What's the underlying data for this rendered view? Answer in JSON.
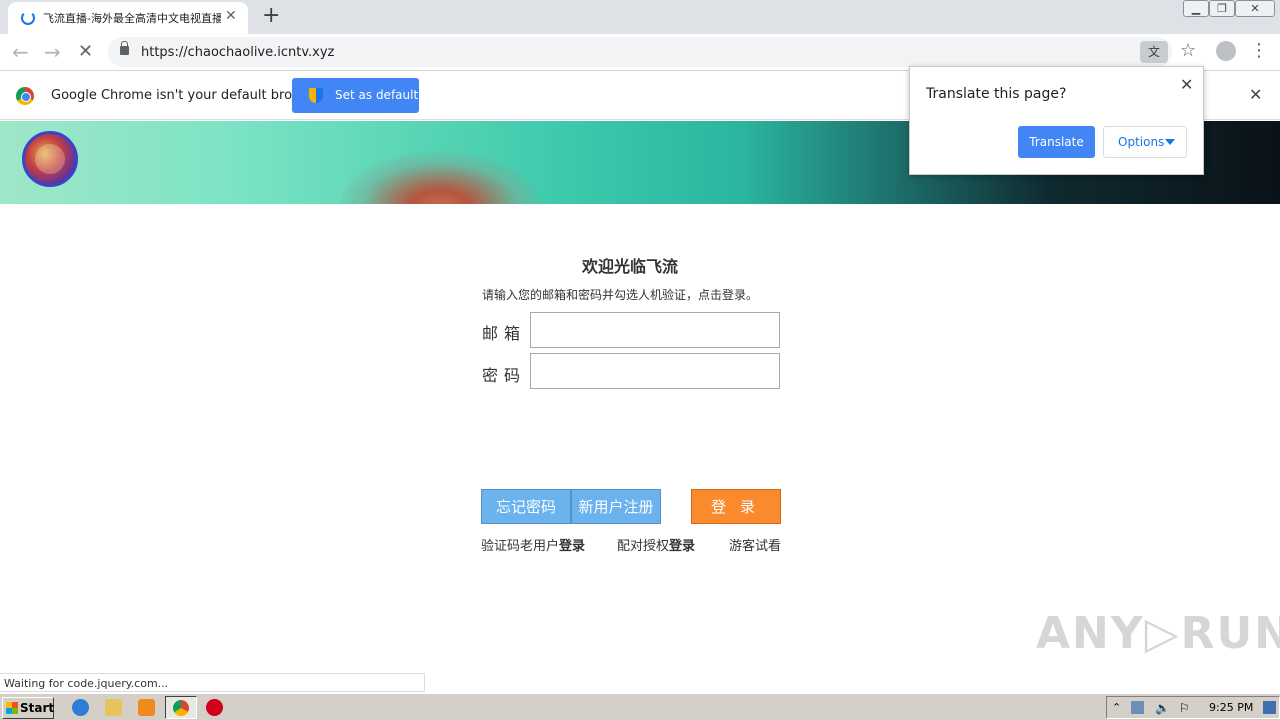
{
  "browser": {
    "tab_title": "飞流直播-海外最全高清中文电视直播",
    "url": "https://chaochaolive.icntv.xyz"
  },
  "infobar": {
    "message": "Google Chrome isn't your default browser",
    "set_default_label": "Set as default"
  },
  "translate_popup": {
    "title": "Translate this page?",
    "translate_label": "Translate",
    "options_label": "Options"
  },
  "login": {
    "title": "欢迎光临飞流",
    "subtitle": "请输入您的邮箱和密码并勾选人机验证，点击登录。",
    "email_label": "邮箱",
    "password_label": "密码",
    "forgot_label": "忘记密码",
    "register_label": "新用户注册",
    "login_label": "登录",
    "link_verify_prefix": "验证码老用户",
    "link_verify_bold": "登录",
    "link_pair_prefix": "配对授权",
    "link_pair_bold": "登录",
    "link_guest": "游客试看"
  },
  "status_bar": "Waiting for code.jquery.com...",
  "watermark": "ANY▷RUN",
  "taskbar": {
    "start_label": "Start",
    "clock": "9:25 PM"
  },
  "colors": {
    "accent_blue": "#4285f4",
    "login_orange": "#fb8a2e",
    "button_blue": "#6ab3ef"
  }
}
